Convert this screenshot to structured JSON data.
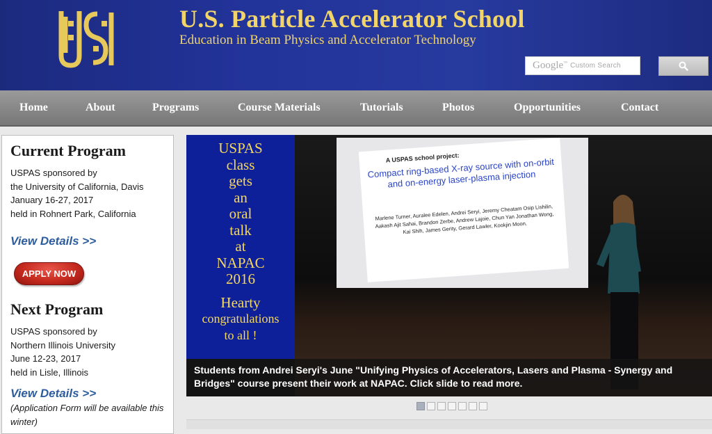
{
  "header": {
    "logo_text": "USPAS",
    "title": "U.S. Particle Accelerator School",
    "subtitle": "Education in Beam Physics and Accelerator Technology",
    "search": {
      "brand": "Google",
      "brand_mark": "™",
      "placeholder": "Custom Search",
      "button_icon": "search-icon"
    }
  },
  "nav": {
    "items": [
      {
        "label": "Home"
      },
      {
        "label": "About"
      },
      {
        "label": "Programs"
      },
      {
        "label": "Course Materials"
      },
      {
        "label": "Tutorials"
      },
      {
        "label": "Photos"
      },
      {
        "label": "Opportunities"
      },
      {
        "label": "Contact"
      }
    ]
  },
  "sidebar": {
    "current": {
      "heading": "Current Program",
      "lines": [
        "USPAS sponsored by",
        "the University of California, Davis",
        "January 16-27, 2017",
        "held in Rohnert Park, California"
      ],
      "link": "View Details >>",
      "apply": "APPLY NOW"
    },
    "next": {
      "heading": "Next Program",
      "lines": [
        "USPAS sponsored by",
        "Northern Illinois University",
        "June 12-23, 2017",
        "held in Lisle, Illinois"
      ],
      "link": "View Details >>",
      "note": "(Application Form will be available this winter)"
    }
  },
  "slide": {
    "blue_panel": [
      "USPAS",
      "class",
      "gets",
      "an",
      "oral",
      "talk",
      "at",
      "NAPAC",
      "2016",
      "Hearty",
      "congratulations",
      "to all !"
    ],
    "screen": {
      "heading": "A USPAS school project:",
      "title": "Compact ring-based X-ray source with on-orbit and on-energy laser-plasma injection",
      "authors": "Marlene Turner, Auralee Edelen, Andrei Seryi, Jeremy Cheatam Osip Lishilin, Aakash Ajit Sahai, Brandon Zerbe, Andrew Lajoie, Chun Yan Jonathan Wong, Kai Shih, James Gerity, Gerard Lawler, Kookjin Moon."
    },
    "caption": "Students from Andrei Seryi's June \"Unifying Physics of Accelerators, Lasers and Plasma - Synergy and Bridges\" course present their work at NAPAC. Click slide to read more.",
    "pagination": {
      "total": 7,
      "active": 1
    }
  },
  "colors": {
    "header_bg": "#22339a",
    "gold": "#f1d46a",
    "link": "#2e5d9f",
    "apply": "#c62a1f",
    "slide_blue": "#0e1f9a",
    "slide_text": "#f5d85e"
  }
}
